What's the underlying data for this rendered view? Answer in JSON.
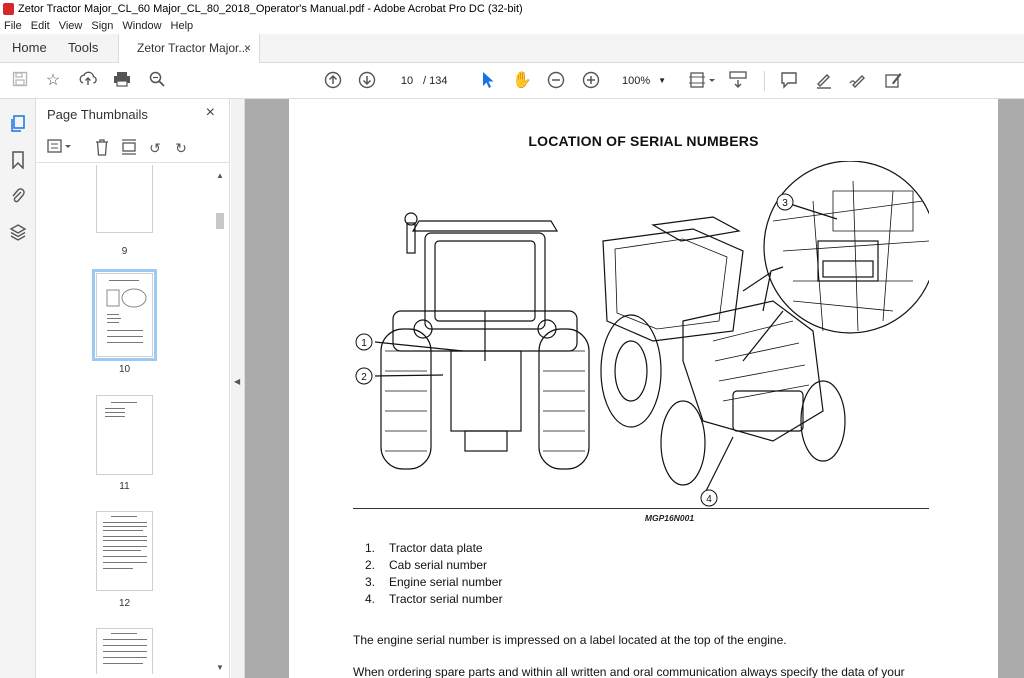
{
  "window": {
    "title": "Zetor Tractor Major_CL_60 Major_CL_80_2018_Operator's Manual.pdf - Adobe Acrobat Pro DC (32-bit)"
  },
  "menu": {
    "items": [
      "File",
      "Edit",
      "View",
      "Sign",
      "Window",
      "Help"
    ]
  },
  "tabs": {
    "home": "Home",
    "tools": "Tools",
    "document": "Zetor Tractor Major...",
    "close": "×"
  },
  "toolbar": {
    "current_page": "10",
    "page_separator": "/",
    "total_pages": "134",
    "zoom": "100%"
  },
  "panel": {
    "title": "Page Thumbnails",
    "close": "×",
    "thumbnails": [
      {
        "label": "9"
      },
      {
        "label": "10",
        "selected": true
      },
      {
        "label": "11"
      },
      {
        "label": "12"
      }
    ]
  },
  "document": {
    "heading": "LOCATION OF SERIAL NUMBERS",
    "figure_caption": "MGP16N001",
    "callouts": [
      "1",
      "2",
      "3",
      "4"
    ],
    "list": [
      {
        "num": "1.",
        "text": "Tractor data plate"
      },
      {
        "num": "2.",
        "text": "Cab serial number"
      },
      {
        "num": "3.",
        "text": "Engine serial number"
      },
      {
        "num": "4.",
        "text": "Tractor serial number"
      }
    ],
    "paragraph_1": "The engine serial number is impressed on a label located at the top of the engine.",
    "paragraph_2": "When ordering spare parts and within all written and oral communication always specify the data of your"
  },
  "colors": {
    "accent": "#1473e6",
    "panel_bg": "#f4f4f4",
    "doc_bg": "#ababab"
  }
}
